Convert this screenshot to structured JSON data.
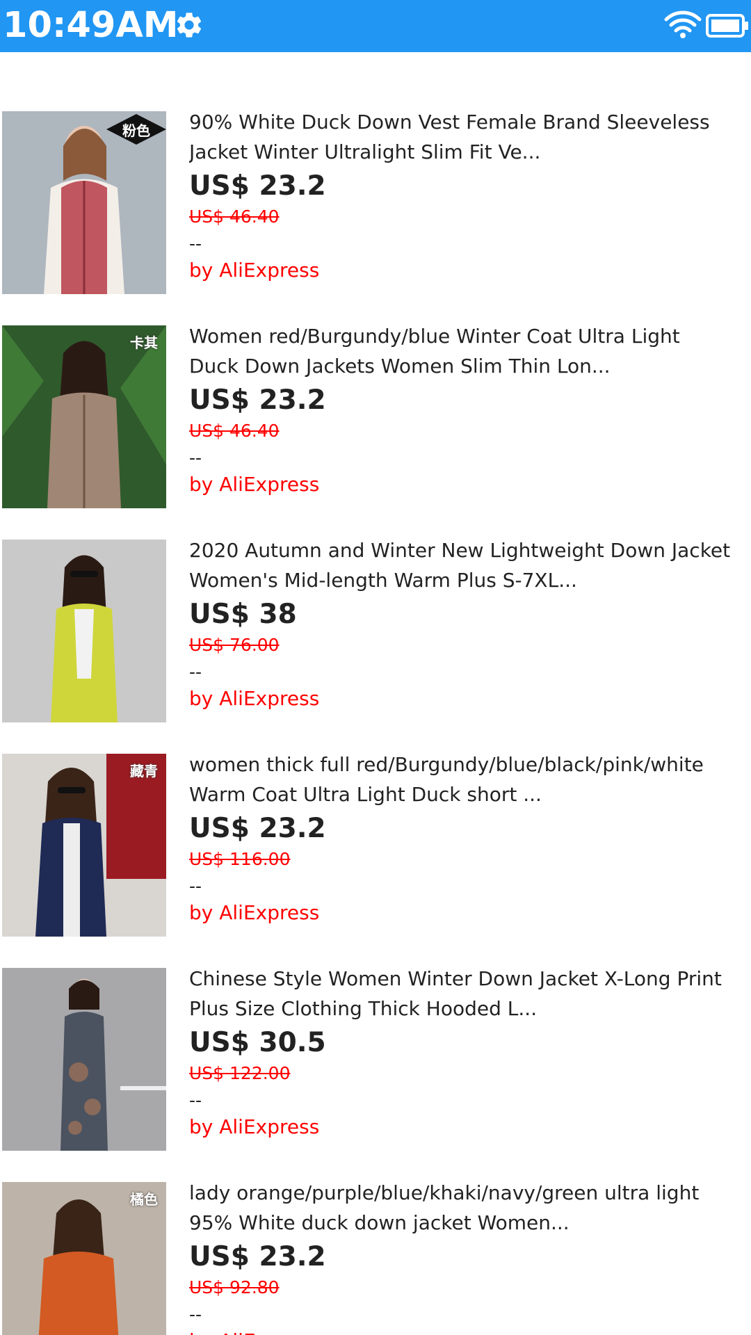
{
  "status_bar": {
    "time": "10:49AM",
    "settings_icon": "gear-icon",
    "wifi_icon": "wifi-icon",
    "battery_icon": "battery-icon",
    "color": "#2196F3"
  },
  "products": [
    {
      "title_line1": "90% White Duck Down Vest Female Brand Sleeveless",
      "title_line2": "Jacket Winter Ultralight Slim Fit Ve...",
      "price": "US$ 23.2",
      "old_price": "US$ 46.40",
      "rating": "--",
      "seller": "by AliExpress",
      "badge": "粉色"
    },
    {
      "title_line1": "Women red/Burgundy/blue Winter Coat Ultra Light",
      "title_line2": "Duck Down Jackets Women Slim Thin Lon...",
      "price": "US$ 23.2",
      "old_price": "US$ 46.40",
      "rating": "--",
      "seller": "by AliExpress",
      "badge": "卡其"
    },
    {
      "title_line1": "2020 Autumn and Winter New Lightweight Down Jacket",
      "title_line2": "Women's Mid-length Warm Plus S-7XL...",
      "price": "US$ 38",
      "old_price": "US$ 76.00",
      "rating": "--",
      "seller": "by AliExpress",
      "badge": ""
    },
    {
      "title_line1": "women thick full red/Burgundy/blue/black/pink/white",
      "title_line2": "Warm Coat Ultra Light Duck short ...",
      "price": "US$ 23.2",
      "old_price": "US$ 116.00",
      "rating": "--",
      "seller": "by AliExpress",
      "badge": "藏青"
    },
    {
      "title_line1": "Chinese Style Women Winter Down Jacket X-Long Print",
      "title_line2": "Plus Size Clothing Thick Hooded L...",
      "price": "US$ 30.5",
      "old_price": "US$ 122.00",
      "rating": "--",
      "seller": "by AliExpress",
      "badge": ""
    },
    {
      "title_line1": "lady orange/purple/blue/khaki/navy/green ultra light",
      "title_line2": "95% White duck down jacket Women...",
      "price": "US$ 23.2",
      "old_price": "US$ 92.80",
      "rating": "--",
      "seller": "by AliExpress",
      "badge": "橘色"
    }
  ]
}
